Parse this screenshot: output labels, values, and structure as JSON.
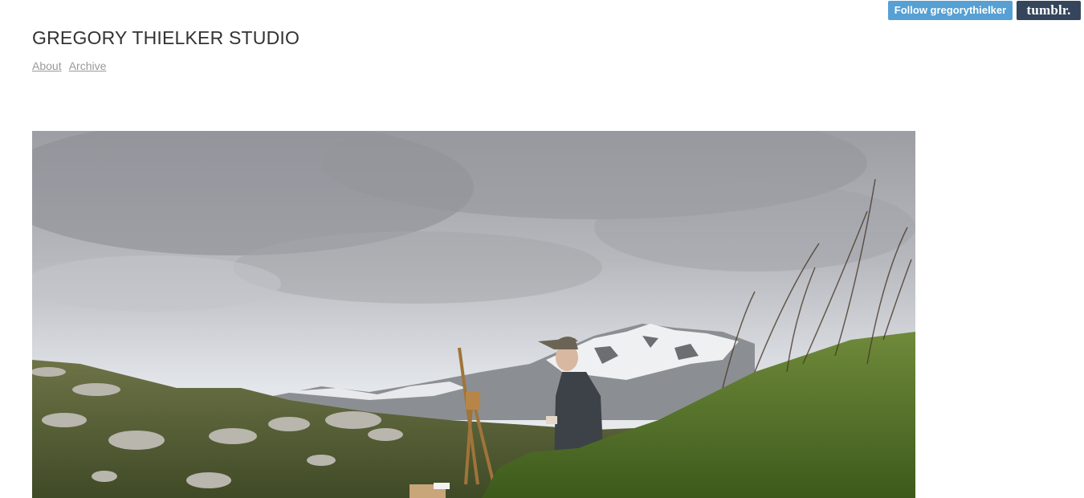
{
  "header": {
    "title": "GREGORY THIELKER STUDIO",
    "nav": [
      "About",
      "Archive"
    ]
  },
  "tumblr_bar": {
    "follow_label": "Follow gregorythielker",
    "logo_text": "tumblr.",
    "follow_color": "#56a0d3",
    "logo_bg": "#35465c"
  },
  "post": {
    "image_icon": "landscape-photo"
  }
}
